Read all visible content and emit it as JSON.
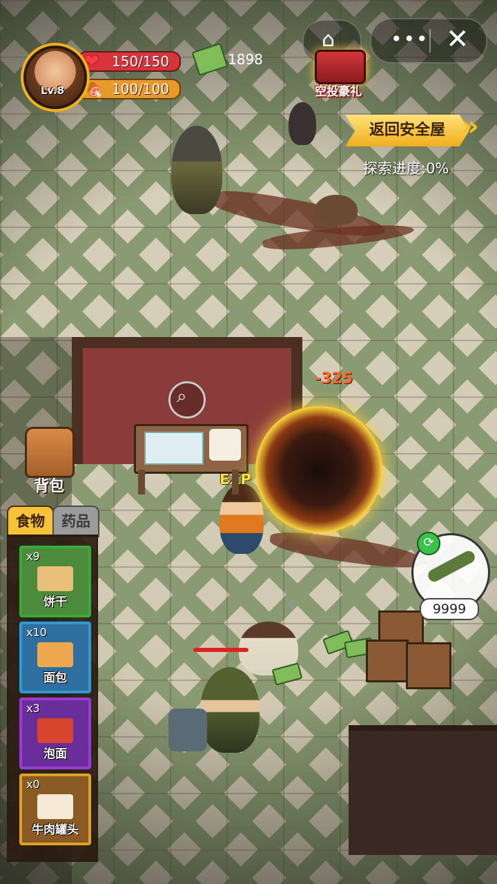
{
  "player": {
    "level": "Lv.8",
    "hp": "150/150",
    "food": "100/100",
    "cash": "1898"
  },
  "hud_icons": {
    "hp": "heart-icon",
    "food": "meat-icon",
    "cash": "cash-icon"
  },
  "top_right": {
    "home_icon": "home-icon",
    "more_label": "•••",
    "close_label": "✕"
  },
  "airdrop": {
    "label": "空投豪礼"
  },
  "return_button": {
    "label": "返回安全屋"
  },
  "exploration": {
    "label": "探索进度:0%"
  },
  "backpack": {
    "label": "背包"
  },
  "tabs": {
    "food": "食物",
    "medicine": "药品"
  },
  "items": [
    {
      "count": "x9",
      "name": "饼干",
      "border": "#3aa83a"
    },
    {
      "count": "x10",
      "name": "面包",
      "border": "#2f9ad8"
    },
    {
      "count": "x3",
      "name": "泡面",
      "border": "#9a3ad8"
    },
    {
      "count": "x0",
      "name": "牛肉罐头",
      "border": "#e0a025"
    }
  ],
  "combat": {
    "damage": "-325",
    "exp": "EXP"
  },
  "weapon": {
    "ammo": "9999"
  }
}
